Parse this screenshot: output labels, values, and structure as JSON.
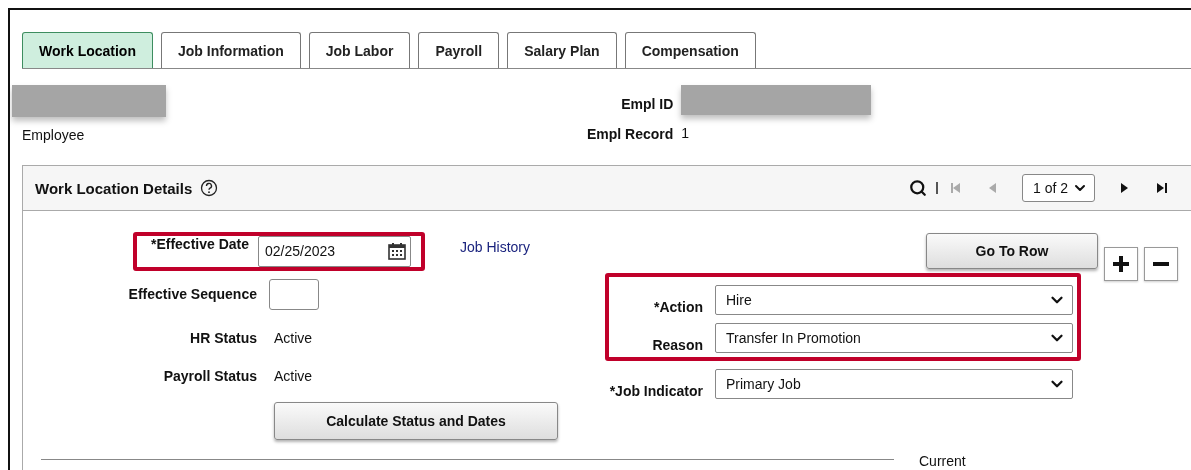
{
  "tabs": [
    {
      "label": "Work Location",
      "selected": true
    },
    {
      "label": "Job Information",
      "selected": false
    },
    {
      "label": "Job Labor",
      "selected": false
    },
    {
      "label": "Payroll",
      "selected": false
    },
    {
      "label": "Salary Plan",
      "selected": false
    },
    {
      "label": "Compensation",
      "selected": false
    }
  ],
  "employee": {
    "label": "Employee",
    "empl_id_label": "Empl ID",
    "empl_record_label": "Empl Record",
    "empl_record": "1"
  },
  "panel": {
    "title": "Work Location Details",
    "pager": "1 of 2",
    "effective_date": {
      "label": "*Effective Date",
      "value": "02/25/2023",
      "highlighted": true
    },
    "job_history_link": "Job History",
    "effective_sequence": {
      "label": "Effective Sequence"
    },
    "statuses": [
      {
        "label": "HR Status",
        "value": "Active"
      },
      {
        "label": "Payroll Status",
        "value": "Active"
      }
    ],
    "calculate_button": "Calculate Status and Dates",
    "go_to_row_button": "Go To Row",
    "selects": [
      {
        "label": "*Action",
        "value": "Hire",
        "highlighted": true
      },
      {
        "label": "Reason",
        "value": "Transfer In Promotion",
        "highlighted": true
      },
      {
        "label": "*Job Indicator",
        "value": "Primary Job",
        "highlighted": false
      }
    ],
    "current_label": "Current"
  }
}
